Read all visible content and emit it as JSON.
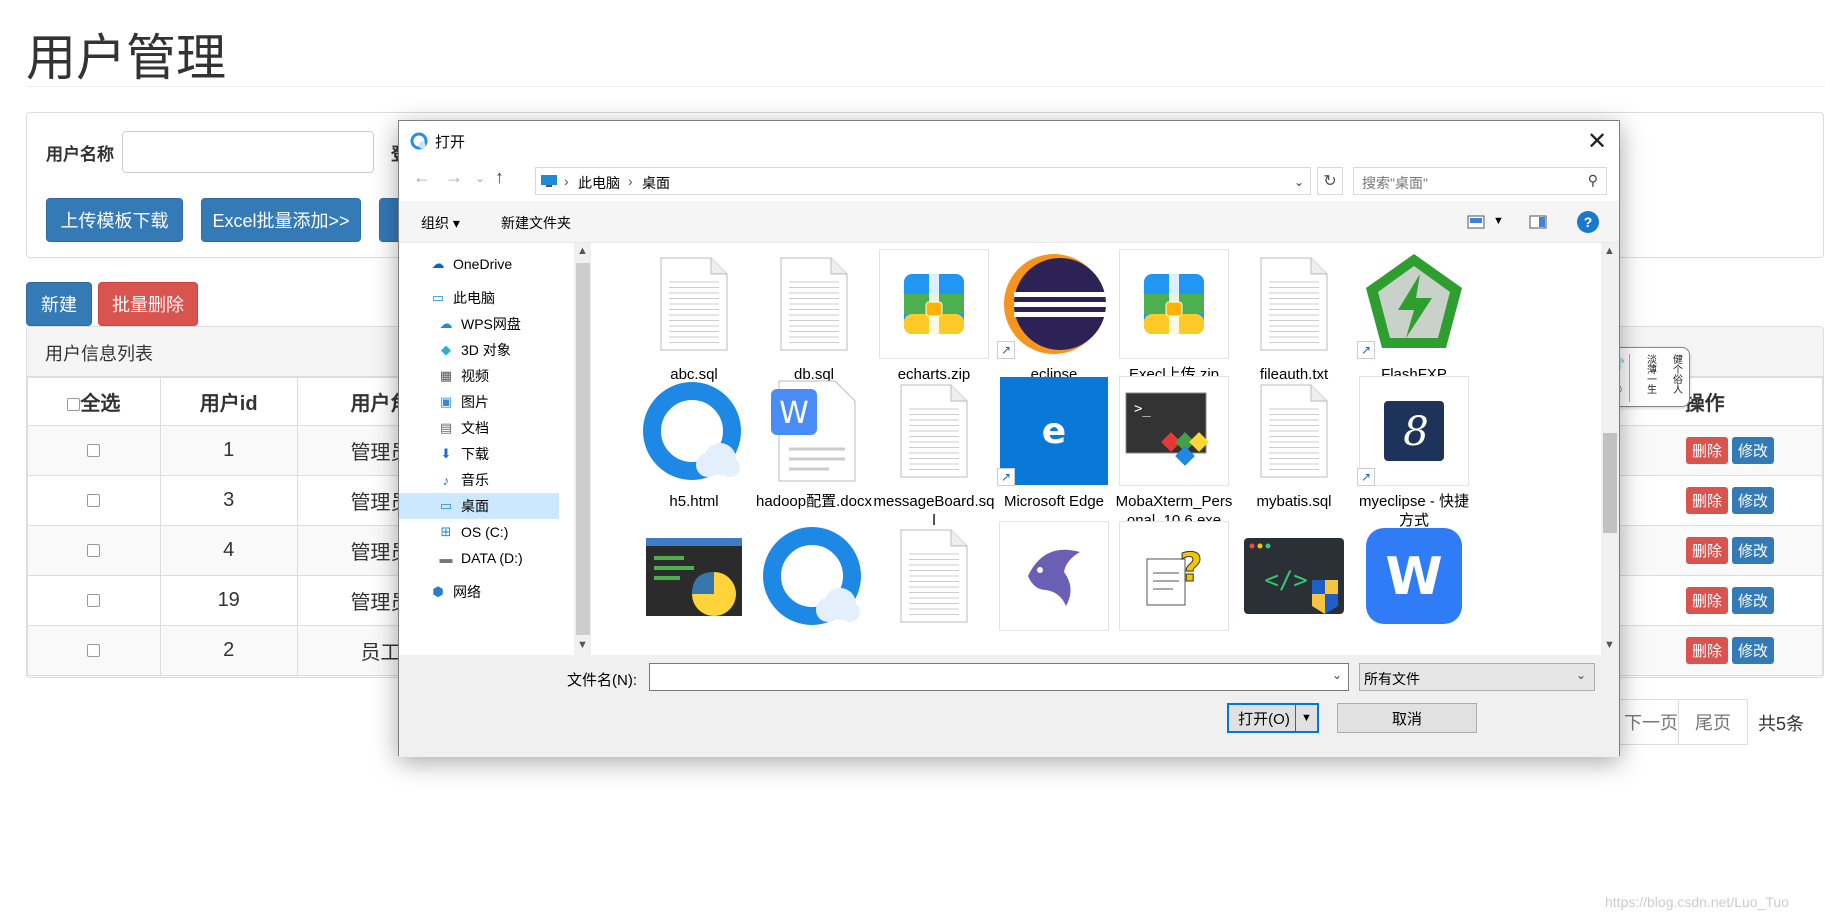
{
  "page": {
    "title": "用户管理",
    "form": {
      "username_label": "用户名称",
      "next_label": "登"
    },
    "buttons": {
      "download_template": "上传模板下载",
      "excel_batch_add": "Excel批量添加>>",
      "new": "新建",
      "batch_delete": "批量删除"
    },
    "list": {
      "heading": "用户信息列表",
      "headers": {
        "select_all": "全选",
        "user_id": "用户id",
        "user_role": "用户角",
        "ops": "操作"
      },
      "rows": [
        {
          "id": "1",
          "role": "管理员"
        },
        {
          "id": "3",
          "role": "管理员"
        },
        {
          "id": "4",
          "role": "管理员"
        },
        {
          "id": "19",
          "role": "管理员"
        },
        {
          "id": "2",
          "role": "员工"
        }
      ],
      "row_delete_label": "删除",
      "row_edit_label": "修改"
    },
    "pager": {
      "next": "下一页",
      "last": "尾页",
      "total": "共5条"
    },
    "watermark": "https://blog.csdn.net/Luo_Tuo"
  },
  "ime": {
    "mode": "中",
    "seal_lines": [
      "健个俗人",
      "淡薄一生"
    ]
  },
  "dialog": {
    "title": "打开",
    "close": "✕",
    "nav": {
      "back": "←",
      "forward": "→",
      "recent": "⌄",
      "up": "↑"
    },
    "address": [
      "此电脑",
      "桌面"
    ],
    "search_placeholder": "搜索\"桌面\"",
    "toolbar": {
      "organize": "组织 ▾",
      "new_folder": "新建文件夹",
      "help": "?"
    },
    "nav_pane": [
      {
        "label": "OneDrive",
        "icon": "cloud-icon"
      },
      {
        "label": "此电脑",
        "icon": "computer-icon"
      },
      {
        "label": "WPS网盘",
        "icon": "cloud-outline-icon"
      },
      {
        "label": "3D 对象",
        "icon": "cube-icon"
      },
      {
        "label": "视频",
        "icon": "video-icon"
      },
      {
        "label": "图片",
        "icon": "picture-icon"
      },
      {
        "label": "文档",
        "icon": "document-icon"
      },
      {
        "label": "下载",
        "icon": "download-icon"
      },
      {
        "label": "音乐",
        "icon": "music-icon"
      },
      {
        "label": "桌面",
        "icon": "desktop-icon",
        "selected": true
      },
      {
        "label": "OS (C:)",
        "icon": "windows-drive-icon"
      },
      {
        "label": "DATA (D:)",
        "icon": "drive-icon"
      },
      {
        "label": "网络",
        "icon": "network-icon"
      }
    ],
    "files": [
      {
        "name": "abc.sql",
        "icon": "text-file-icon"
      },
      {
        "name": "db.sql",
        "icon": "text-file-icon"
      },
      {
        "name": "echarts.zip",
        "icon": "zip-icon"
      },
      {
        "name": "eclipse",
        "icon": "eclipse-icon"
      },
      {
        "name": "Execl上传.zip",
        "icon": "zip-icon"
      },
      {
        "name": "fileauth.txt",
        "icon": "text-file-icon"
      },
      {
        "name": "FlashFXP",
        "icon": "flashfxp-icon"
      },
      {
        "name": "h5.html",
        "icon": "browser-icon"
      },
      {
        "name": "hadoop配置.docx",
        "icon": "wps-doc-icon"
      },
      {
        "name": "messageBoard.sql",
        "icon": "text-file-icon"
      },
      {
        "name": "Microsoft Edge",
        "icon": "edge-icon"
      },
      {
        "name": "MobaXterm_Personal_10.6.exe",
        "icon": "mobaxterm-icon"
      },
      {
        "name": "mybatis.sql",
        "icon": "text-file-icon"
      },
      {
        "name": "myeclipse - 快捷方式",
        "icon": "myeclipse-icon"
      },
      {
        "name": "",
        "icon": "python-icon"
      },
      {
        "name": "",
        "icon": "browser-icon"
      },
      {
        "name": "",
        "icon": "text-file-icon"
      },
      {
        "name": "",
        "icon": "dolphin-icon"
      },
      {
        "name": "",
        "icon": "help-file-icon"
      },
      {
        "name": "",
        "icon": "code-editor-icon"
      },
      {
        "name": "",
        "icon": "wps-icon"
      }
    ],
    "filename_label": "文件名(N):",
    "filename_value": "",
    "filetype": "所有文件",
    "open_button": "打开(O)",
    "cancel_button": "取消"
  },
  "colors": {
    "primary": "#337ab7",
    "danger": "#d9534f",
    "selection": "#cce8ff",
    "win_blue": "#0078d7"
  }
}
